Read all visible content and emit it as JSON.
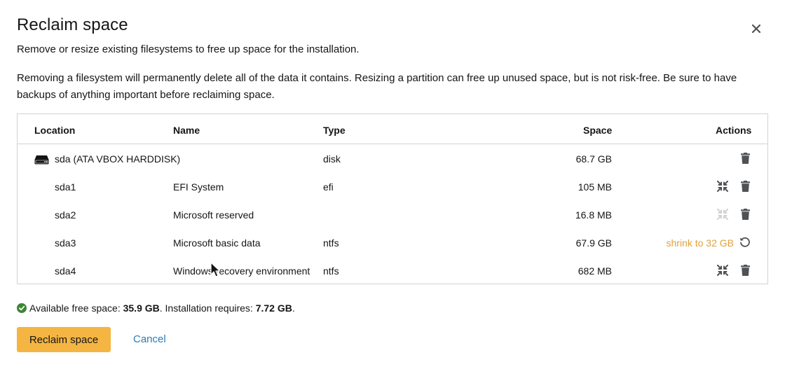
{
  "dialog": {
    "title": "Reclaim space",
    "description": "Remove or resize existing filesystems to free up space for the installation.",
    "warning": "Removing a filesystem will permanently delete all of the data it contains. Resizing a partition can free up unused space, but is not risk-free. Be sure to have backups of anything important before reclaiming space."
  },
  "table": {
    "headers": {
      "location": "Location",
      "name": "Name",
      "type": "Type",
      "space": "Space",
      "actions": "Actions"
    },
    "rows": [
      {
        "location": "sda (ATA VBOX HARDDISK)",
        "name": "",
        "type": "disk",
        "space": "68.7 GB",
        "icon": "harddisk-icon",
        "actions": [
          "delete"
        ]
      },
      {
        "location": "sda1",
        "name": "EFI System",
        "type": "efi",
        "space": "105 MB",
        "actions": [
          "shrink",
          "delete"
        ]
      },
      {
        "location": "sda2",
        "name": "Microsoft reserved",
        "type": "",
        "space": "16.8 MB",
        "actions": [
          "shrink-disabled",
          "delete"
        ]
      },
      {
        "location": "sda3",
        "name": "Microsoft basic data",
        "type": "ntfs",
        "space": "67.9 GB",
        "action_label": "shrink to 32 GB",
        "actions": [
          "undo"
        ]
      },
      {
        "location": "sda4",
        "name": "Windows recovery environment",
        "type": "ntfs",
        "space": "682 MB",
        "actions": [
          "shrink",
          "delete"
        ]
      }
    ]
  },
  "status": {
    "available_label": "Available free space:",
    "available_value": "35.9 GB",
    "requires_label": ". Installation requires:",
    "requires_value": "7.72 GB",
    "end": "."
  },
  "footer": {
    "primary_label": "Reclaim space",
    "cancel_label": "Cancel"
  },
  "colors": {
    "accent": "#f4b542",
    "shrink_text": "#e0a23a",
    "link": "#2b7bb9",
    "success": "#3e8635",
    "icon": "#4f5255",
    "icon_disabled": "#d2d2d2"
  }
}
